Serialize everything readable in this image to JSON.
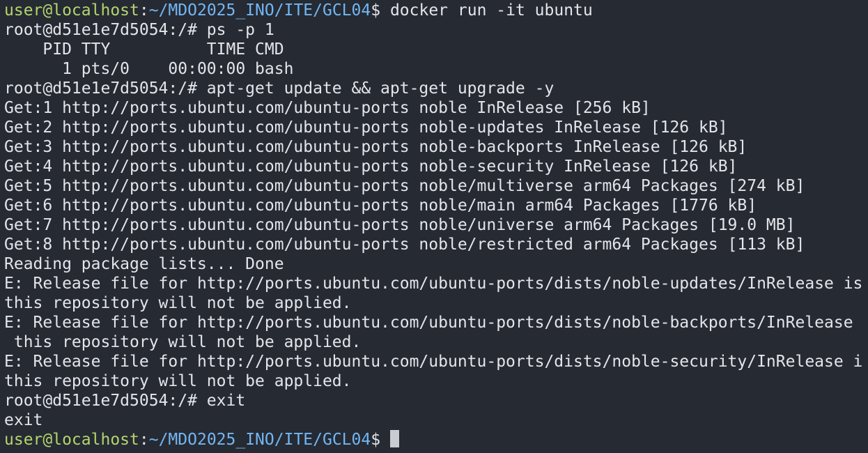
{
  "terminal": {
    "colors": {
      "background": "#262a33",
      "foreground": "#e3e5ea",
      "prompt_user_host": "#b5d46c",
      "prompt_path": "#72b6f2",
      "cursor": "#c9ccd3"
    },
    "lines": [
      {
        "type": "prompt",
        "user_host": "user@localhost",
        "separator": ":",
        "path": "~/MDO2025_INO/ITE/GCL04",
        "symbol": "$",
        "command": " docker run -it ubuntu"
      },
      {
        "type": "output",
        "text": "root@d51e1e7d5054:/# ps -p 1"
      },
      {
        "type": "output",
        "text": "    PID TTY          TIME CMD"
      },
      {
        "type": "output",
        "text": "      1 pts/0    00:00:00 bash"
      },
      {
        "type": "output",
        "text": "root@d51e1e7d5054:/# apt-get update && apt-get upgrade -y"
      },
      {
        "type": "output",
        "text": "Get:1 http://ports.ubuntu.com/ubuntu-ports noble InRelease [256 kB]"
      },
      {
        "type": "output",
        "text": "Get:2 http://ports.ubuntu.com/ubuntu-ports noble-updates InRelease [126 kB]"
      },
      {
        "type": "output",
        "text": "Get:3 http://ports.ubuntu.com/ubuntu-ports noble-backports InRelease [126 kB]"
      },
      {
        "type": "output",
        "text": "Get:4 http://ports.ubuntu.com/ubuntu-ports noble-security InRelease [126 kB]"
      },
      {
        "type": "output",
        "text": "Get:5 http://ports.ubuntu.com/ubuntu-ports noble/multiverse arm64 Packages [274 kB]"
      },
      {
        "type": "output",
        "text": "Get:6 http://ports.ubuntu.com/ubuntu-ports noble/main arm64 Packages [1776 kB]"
      },
      {
        "type": "output",
        "text": "Get:7 http://ports.ubuntu.com/ubuntu-ports noble/universe arm64 Packages [19.0 MB]"
      },
      {
        "type": "output",
        "text": "Get:8 http://ports.ubuntu.com/ubuntu-ports noble/restricted arm64 Packages [113 kB]"
      },
      {
        "type": "output",
        "text": "Reading package lists... Done"
      },
      {
        "type": "output",
        "text": "E: Release file for http://ports.ubuntu.com/ubuntu-ports/dists/noble-updates/InRelease is"
      },
      {
        "type": "output",
        "text": "this repository will not be applied."
      },
      {
        "type": "output",
        "text": "E: Release file for http://ports.ubuntu.com/ubuntu-ports/dists/noble-backports/InRelease"
      },
      {
        "type": "output",
        "text": " this repository will not be applied."
      },
      {
        "type": "output",
        "text": "E: Release file for http://ports.ubuntu.com/ubuntu-ports/dists/noble-security/InRelease i"
      },
      {
        "type": "output",
        "text": "this repository will not be applied."
      },
      {
        "type": "output",
        "text": "root@d51e1e7d5054:/# exit"
      },
      {
        "type": "output",
        "text": "exit"
      },
      {
        "type": "prompt",
        "user_host": "user@localhost",
        "separator": ":",
        "path": "~/MDO2025_INO/ITE/GCL04",
        "symbol": "$",
        "command": " ",
        "cursor": true
      }
    ]
  }
}
